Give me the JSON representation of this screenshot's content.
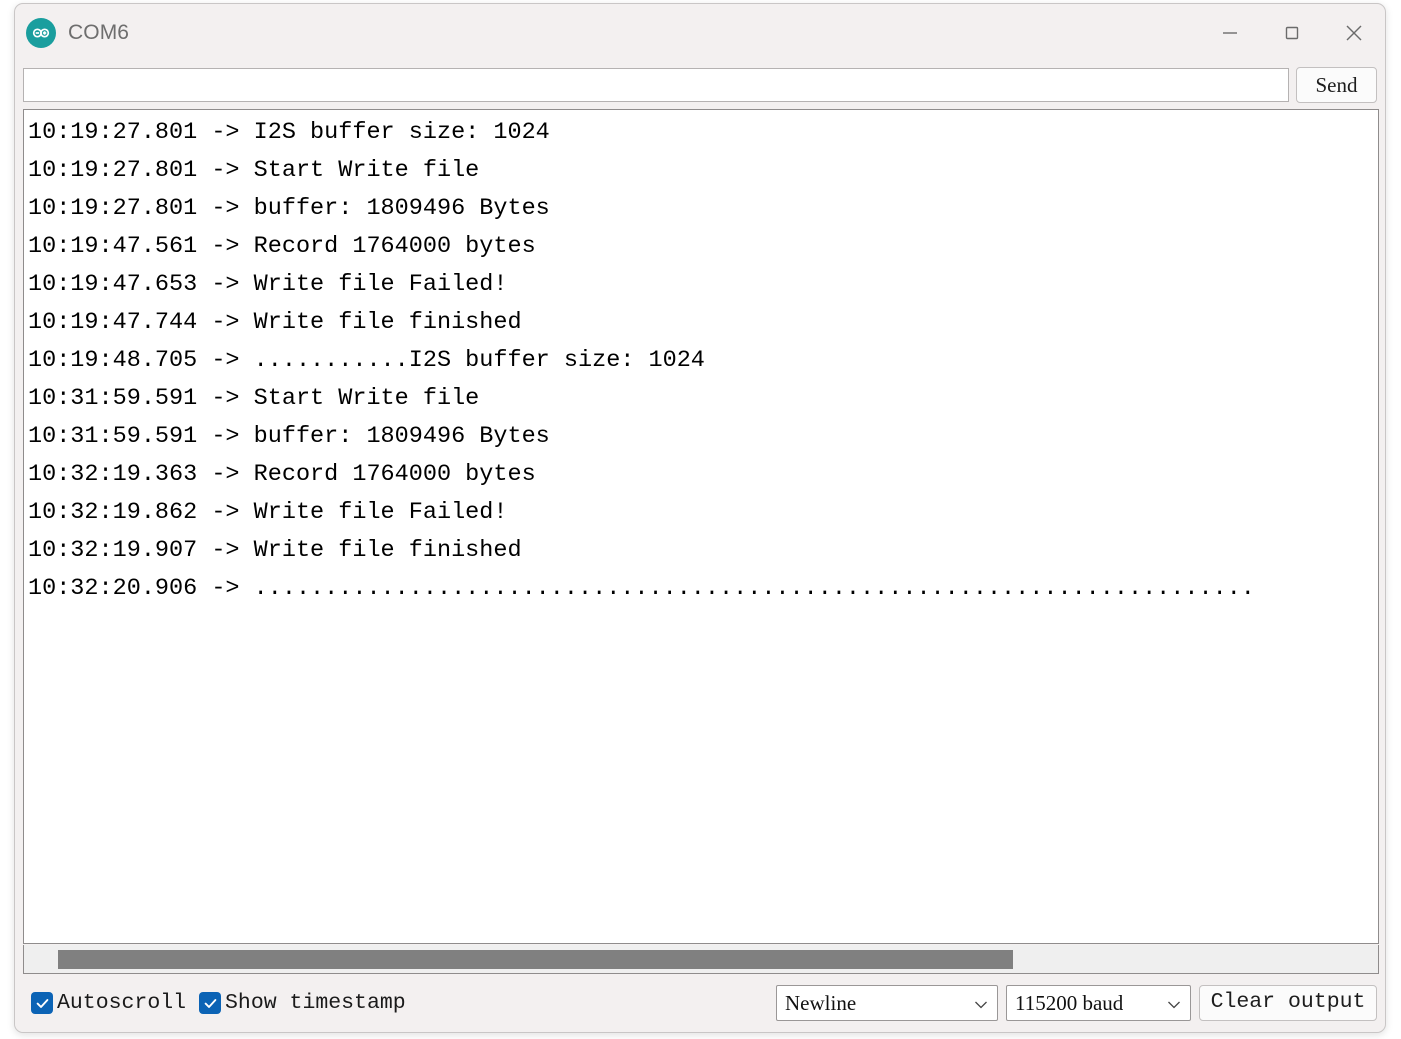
{
  "window": {
    "title": "COM6",
    "logo_icon": "arduino-infinity-icon",
    "controls": [
      {
        "name": "minimize",
        "icon": "minimize-icon"
      },
      {
        "name": "maximize",
        "icon": "maximize-icon"
      },
      {
        "name": "close",
        "icon": "close-icon"
      }
    ]
  },
  "send_bar": {
    "input_value": "",
    "input_placeholder": "",
    "send_label": "Send"
  },
  "log": {
    "lines": [
      "10:19:27.801 -> I2S buffer size: 1024",
      "10:19:27.801 -> Start Write file",
      "10:19:27.801 -> buffer: 1809496 Bytes",
      "10:19:47.561 -> Record 1764000 bytes",
      "10:19:47.653 -> Write file Failed!",
      "10:19:47.744 -> Write file finished",
      "10:19:48.705 -> ...........I2S buffer size: 1024",
      "10:31:59.591 -> Start Write file",
      "10:31:59.591 -> buffer: 1809496 Bytes",
      "10:32:19.363 -> Record 1764000 bytes",
      "10:32:19.862 -> Write file Failed!",
      "10:32:19.907 -> Write file finished",
      "10:32:20.906 -> ......................................................................."
    ],
    "text": "10:19:27.801 -> I2S buffer size: 1024\n10:19:27.801 -> Start Write file\n10:19:27.801 -> buffer: 1809496 Bytes\n10:19:47.561 -> Record 1764000 bytes\n10:19:47.653 -> Write file Failed!\n10:19:47.744 -> Write file finished\n10:19:48.705 -> ...........I2S buffer size: 1024\n10:31:59.591 -> Start Write file\n10:31:59.591 -> buffer: 1809496 Bytes\n10:32:19.363 -> Record 1764000 bytes\n10:32:19.862 -> Write file Failed!\n10:32:19.907 -> Write file finished\n10:32:20.906 -> ......................................................................."
  },
  "scrollbar": {
    "orientation": "horizontal",
    "thumb_start_pct": 2.5,
    "thumb_width_pct": 70
  },
  "status_bar": {
    "autoscroll_label": "Autoscroll",
    "autoscroll_checked": true,
    "show_timestamp_label": "Show timestamp",
    "show_timestamp_checked": true,
    "line_ending_value": "Newline",
    "baud_value": "115200 baud",
    "clear_output_label": "Clear output"
  },
  "colors": {
    "accent_checkbox": "#0b63b5",
    "logo_teal": "#1a9e9e",
    "scrollbar_thumb": "#808080",
    "window_chrome": "#f3f0f0",
    "log_background": "#ffffff",
    "log_text": "#000000"
  }
}
